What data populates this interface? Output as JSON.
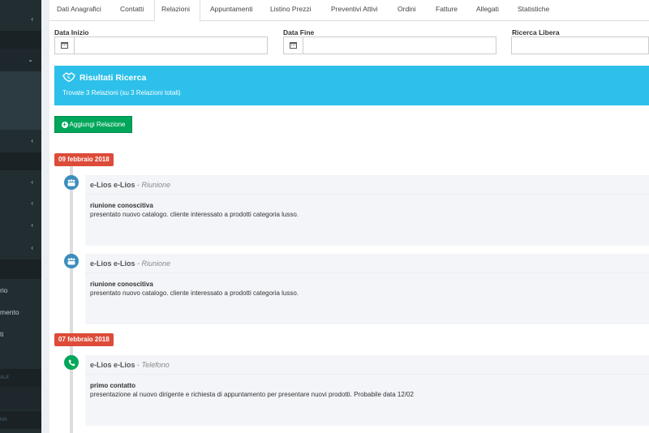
{
  "sidebar": {
    "header_1": "ALE",
    "header_2": "MA",
    "items": [
      {
        "label": "rio"
      },
      {
        "label": "mento"
      },
      {
        "label": "ti"
      }
    ]
  },
  "tabs": [
    {
      "label": "Dati Anagrafici"
    },
    {
      "label": "Contatti"
    },
    {
      "label": "Relazioni"
    },
    {
      "label": "Appuntamenti"
    },
    {
      "label": "Listino Prezzi"
    },
    {
      "label": "Preventivi Attivi"
    },
    {
      "label": "Ordini"
    },
    {
      "label": "Fatture"
    },
    {
      "label": "Allegati"
    },
    {
      "label": "Statistiche"
    }
  ],
  "filters": {
    "start_label": "Data Inizio",
    "start_value": "",
    "end_label": "Data Fine",
    "end_value": "",
    "search_label": "Ricerca Libera",
    "search_value": ""
  },
  "results": {
    "title": "Risultati Ricerca",
    "subtitle": "Trovate 3 Relazioni (su 3 Relazioni totali)"
  },
  "add_button": "Aggiungi Relazione",
  "timeline": {
    "dates": [
      "09 febbraio 2018",
      "07 febbraio 2018"
    ],
    "entries": [
      {
        "who": "e-Lios e-Lios",
        "sep": " - ",
        "type": "Riunione",
        "title": "riunione conoscitiva",
        "body": "presentato nuovo catalogo. cliente interessato a prodotti categoria lusso."
      },
      {
        "who": "e-Lios e-Lios",
        "sep": " - ",
        "type": "Riunione",
        "title": "riunione conoscitiva",
        "body": "presentato nuovo catalogo. cliente interessato a prodotti categoria lusso."
      },
      {
        "who": "e-Lios e-Lios",
        "sep": " - ",
        "type": "Telefono",
        "title": "primo contatto",
        "body": "presentazione al nuovo dirigente e richiesta di appuntamento per presentare nuovi prodotti. Probabile data 12/02"
      }
    ]
  },
  "colors": {
    "info": "#2dc0ea",
    "success": "#00a65a",
    "danger": "#dd4b39",
    "primary": "#3c8dbc",
    "sidebar": "#222d32"
  }
}
